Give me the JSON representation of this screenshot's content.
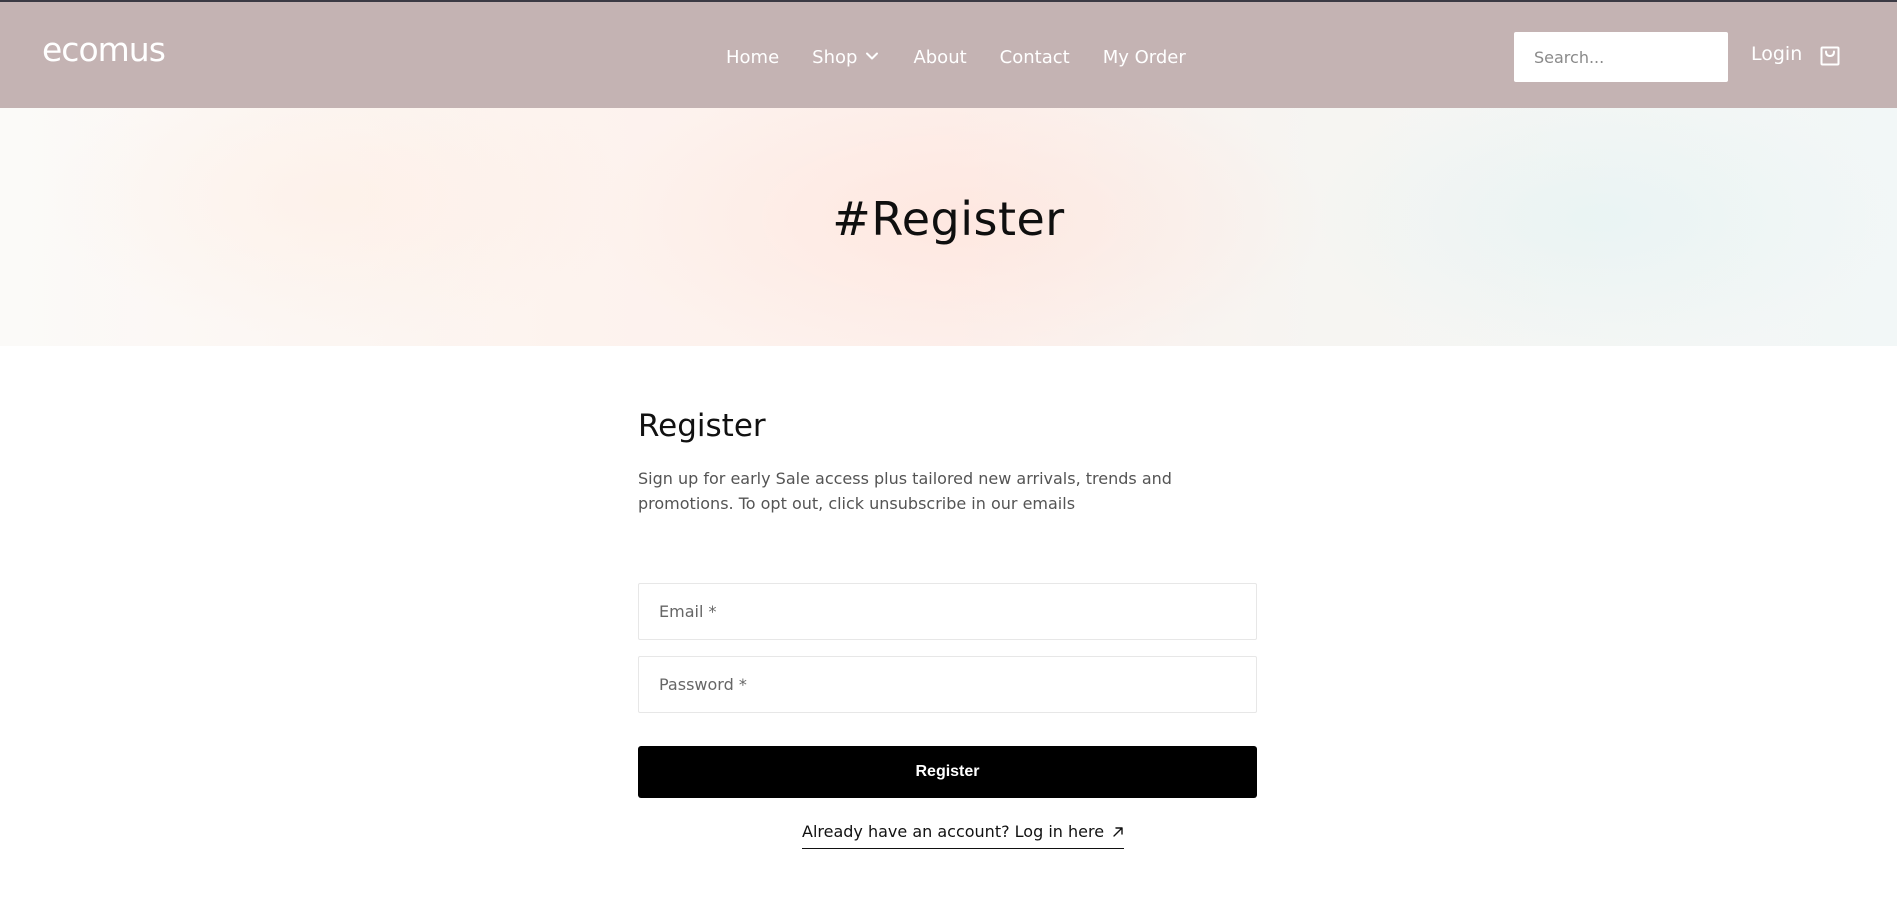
{
  "header": {
    "logo": "ecomus",
    "nav": [
      {
        "label": "Home"
      },
      {
        "label": "Shop",
        "has_dropdown": true
      },
      {
        "label": "About"
      },
      {
        "label": "Contact"
      },
      {
        "label": "My Order"
      }
    ],
    "search_placeholder": "Search...",
    "login_label": "Login",
    "cart_icon": "shopping-bag-icon",
    "background_color": "#c4b3b3"
  },
  "hero": {
    "title": "#Register"
  },
  "form": {
    "title": "Register",
    "description": "Sign up for early Sale access plus tailored new arrivals, trends and promotions. To opt out, click unsubscribe in our emails",
    "email_placeholder": "Email *",
    "password_placeholder": "Password *",
    "submit_label": "Register",
    "login_link_label": "Already have an account? Log in here",
    "login_link_icon": "arrow-up-right-icon"
  }
}
